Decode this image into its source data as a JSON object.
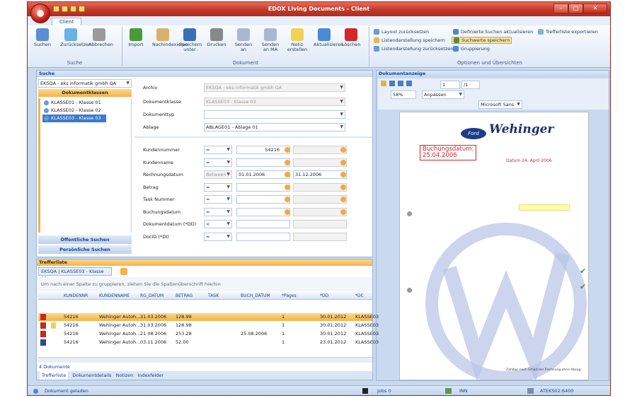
{
  "window": {
    "title": "EDOX Living Documents - Client"
  },
  "ribbon": {
    "tab": "Client",
    "groups": {
      "suche": "Suche",
      "dokument": "Dokument",
      "optionen": "Optionen und Übersichten"
    },
    "suche_buttons": [
      {
        "l1": "Suchen",
        "l2": ""
      },
      {
        "l1": "Zurücksetzen",
        "l2": ""
      },
      {
        "l1": "Abbrechen",
        "l2": ""
      }
    ],
    "dokument_buttons": [
      {
        "l1": "Import",
        "l2": ""
      },
      {
        "l1": "Nachindexieren",
        "l2": ""
      },
      {
        "l1": "Speichern",
        "l2": "unter"
      },
      {
        "l1": "Drucken",
        "l2": ""
      },
      {
        "l1": "Senden",
        "l2": "an"
      },
      {
        "l1": "Senden",
        "l2": "an MA"
      },
      {
        "l1": "Notiz",
        "l2": "erstellen"
      },
      {
        "l1": "Aktualisieren",
        "l2": ""
      },
      {
        "l1": "Löschen",
        "l2": ""
      }
    ],
    "optionen": {
      "layout_reset": "Layout zurücksetzen",
      "list_save": "Listendarstellung speichern",
      "list_reset": "Listendarstellung zurücksetzen",
      "def_search": "Definierte Suchen aktualisieren",
      "save_search": "Suchwerte speichern",
      "grouping": "Gruppierung",
      "export": "Trefferliste exportieren"
    }
  },
  "search": {
    "title": "Suche",
    "db": "EKSQA - eks informatik gmbh QA",
    "doc_classes_header": "Dokumentklassen",
    "tree": [
      "KLASSE01 - Klasse 01",
      "KLASSE02 - Klasse 02",
      "KLASSE03 - Klasse 03"
    ],
    "public_searches": "Öffentliche Suchen",
    "personal_searches": "Persönliche Suchen",
    "fields": {
      "archiv_label": "Archiv",
      "archiv": "EKSQA - eks informatik gmbh QA",
      "klasse_label": "Dokumentklasse",
      "klasse": "KLASSE03 - Klasse 03",
      "typ_label": "Dokumenttyp",
      "typ": "",
      "ablage_label": "Ablage",
      "ablage": "ABLAGE01 - Ablage 01"
    },
    "criteria": [
      {
        "label": "Kundennummer",
        "op": "=",
        "v1": "54216",
        "v2": ""
      },
      {
        "label": "Kundenname",
        "op": "=",
        "v1": "",
        "v2": ""
      },
      {
        "label": "Rechnungsdatum",
        "op": "Between",
        "v1": "01.01.2006",
        "v2": "31.12.2006"
      },
      {
        "label": "Betrag",
        "op": "=",
        "v1": "",
        "v2": ""
      },
      {
        "label": "Task Nummer",
        "op": "=",
        "v1": "",
        "v2": ""
      },
      {
        "label": "Buchungsdatum",
        "op": "=",
        "v1": "",
        "v2": ""
      },
      {
        "label": "Dokumentdatum (*DD)",
        "op": "<",
        "v1": "",
        "v2": ""
      },
      {
        "label": "DocID (*DI)",
        "op": "=",
        "v1": "",
        "v2": ""
      }
    ]
  },
  "results": {
    "title": "Trefferliste",
    "tab": "EKSQA | KLASSE03 - Klasse 03",
    "group_hint": "Um nach einer Spalte zu gruppieren, ziehen Sie die Spaltenüberschrift hierhin",
    "columns": [
      "KUNDENNR",
      "KUNDENNAME",
      "RG_DATUM",
      "BETRAG",
      "TASK",
      "BUCH_DATUM",
      "*Pages",
      "*DD",
      "*DC"
    ],
    "rows": [
      [
        "54216",
        "Wehinger Autoh...",
        "31.03.2006",
        "128.98",
        "",
        "",
        "1",
        "30.01.2012",
        "KLASSE03"
      ],
      [
        "54216",
        "Wehinger Autoh...",
        "31.03.2006",
        "128.98",
        "",
        "",
        "1",
        "30.01.2012",
        "KLASSE03"
      ],
      [
        "54216",
        "Wehinger Autoh...",
        "21.08.2006",
        "253.28",
        "",
        "25.08.2006",
        "1",
        "30.01.2012",
        "KLASSE03"
      ],
      [
        "54216",
        "Wehinger Autoh...",
        "03.11.2006",
        "52.00",
        "",
        "",
        "1",
        "23.01.2012",
        "KLASSE03"
      ]
    ],
    "count": "4 Dokumente",
    "bottom_tabs": [
      "Trefferliste",
      "Dokumentdetails",
      "Notizen",
      "Indexfelder"
    ]
  },
  "viewer": {
    "title": "Dokumentanzeige",
    "page": "1",
    "pages": "/1",
    "zoom": "58%",
    "fit": "Anpassen",
    "font": "Microsoft Sans",
    "stamp1": "Buchungsdatum:",
    "stamp2": "25.04.2006",
    "logo1": "Ford",
    "logo2": "Wehinger",
    "note": "Datum 24. April 2006",
    "footer": "Zahlbar nach Erhalt der Rechnung ohne Abzug."
  },
  "status": {
    "msg": "Dokument geladen",
    "jobs": "Jobs 0",
    "inn": "INN",
    "host": "ATEKS02:6400"
  }
}
